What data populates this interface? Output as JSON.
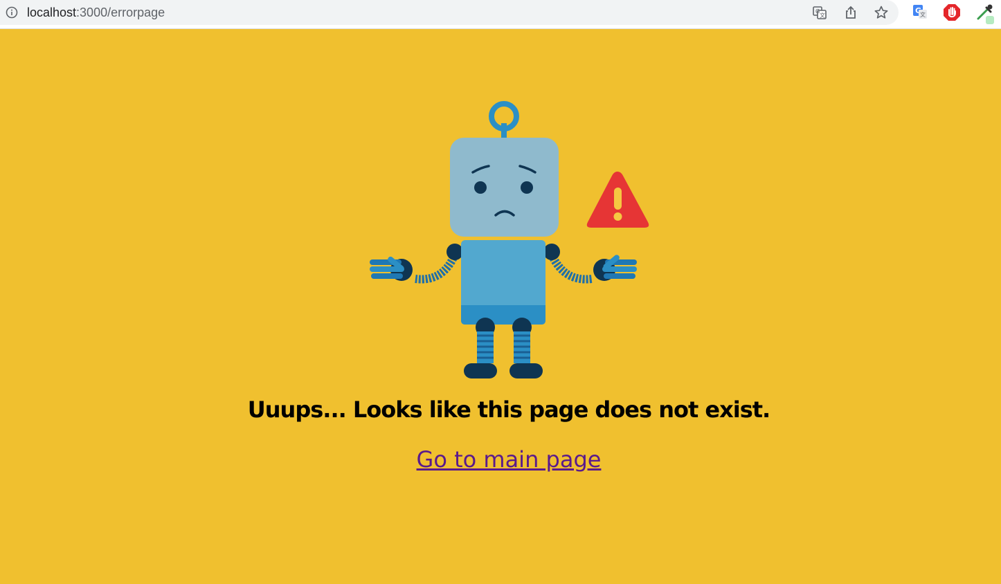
{
  "browser": {
    "url_host": "localhost",
    "url_path": ":3000/errorpage",
    "icons": [
      "info-icon",
      "translate-icon",
      "share-icon",
      "bookmark-star-icon",
      "google-translate-extension-icon",
      "adblock-extension-icon",
      "eyedropper-extension-icon"
    ]
  },
  "page": {
    "background_color": "#f0c02f",
    "headline": "Uuups... Looks like this page does not exist.",
    "link_label": "Go to main page",
    "link_color": "#5a1a8c",
    "illustration": "sad-robot-with-warning-sign"
  }
}
